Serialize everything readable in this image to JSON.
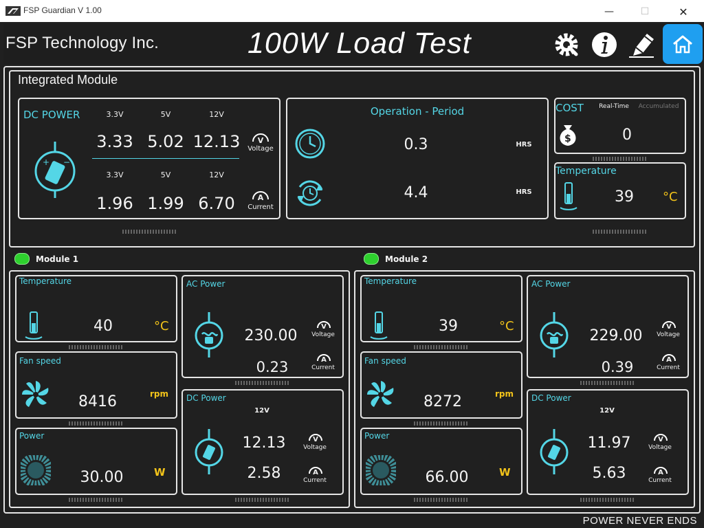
{
  "window": {
    "title": "FSP Guardian V 1.00",
    "controls": {
      "minimize": "—",
      "maximize": "☐",
      "close": "✕"
    }
  },
  "header": {
    "company": "FSP Technology Inc.",
    "test_title": "100W Load Test",
    "icons": [
      "settings-icon",
      "info-icon",
      "edit-icon",
      "home-icon"
    ]
  },
  "integrated": {
    "title": "Integrated Module",
    "dc_power": {
      "label": "DC POWER",
      "rails": [
        "3.3V",
        "5V",
        "12V"
      ],
      "voltage": [
        "3.33",
        "5.02",
        "12.13"
      ],
      "current_rails": [
        "3.3V",
        "5V",
        "12V"
      ],
      "current": [
        "1.96",
        "1.99",
        "6.70"
      ],
      "voltage_unit": "V",
      "voltage_label": "Voltage",
      "current_unit": "A",
      "current_label": "Current"
    },
    "operation": {
      "label": "Operation - Period",
      "period_value": "0.3",
      "period_unit": "HRS",
      "total_value": "4.4",
      "total_unit": "HRS"
    },
    "cost": {
      "label": "COST",
      "tab_realtime": "Real-Time",
      "tab_accumulated": "Accumulated",
      "value": "0"
    },
    "temperature": {
      "label": "Temperature",
      "value": "39",
      "unit": "°C"
    }
  },
  "modules": [
    {
      "name": "Module 1",
      "status_color": "#2ed12e",
      "temperature": {
        "label": "Temperature",
        "value": "40",
        "unit": "°C"
      },
      "fan": {
        "label": "Fan speed",
        "value": "8416",
        "unit": "rpm"
      },
      "power": {
        "label": "Power",
        "value": "30.00",
        "unit": "W"
      },
      "ac": {
        "label": "AC Power",
        "voltage": "230.00",
        "current": "0.23",
        "voltage_unit": "V",
        "voltage_label": "Voltage",
        "current_unit": "A",
        "current_label": "Current"
      },
      "dc": {
        "label": "DC Power",
        "rail": "12V",
        "voltage": "12.13",
        "current": "2.58",
        "voltage_unit": "V",
        "voltage_label": "Voltage",
        "current_unit": "A",
        "current_label": "Current"
      }
    },
    {
      "name": "Module 2",
      "status_color": "#2ed12e",
      "temperature": {
        "label": "Temperature",
        "value": "39",
        "unit": "°C"
      },
      "fan": {
        "label": "Fan speed",
        "value": "8272",
        "unit": "rpm"
      },
      "power": {
        "label": "Power",
        "value": "66.00",
        "unit": "W"
      },
      "ac": {
        "label": "AC Power",
        "voltage": "229.00",
        "current": "0.39",
        "voltage_unit": "V",
        "voltage_label": "Voltage",
        "current_unit": "A",
        "current_label": "Current"
      },
      "dc": {
        "label": "DC Power",
        "rail": "12V",
        "voltage": "11.97",
        "current": "5.63",
        "voltage_unit": "V",
        "voltage_label": "Voltage",
        "current_unit": "A",
        "current_label": "Current"
      }
    }
  ],
  "footer": {
    "slogan": "POWER NEVER ENDS"
  },
  "colors": {
    "accent_cyan": "#54d6e6",
    "unit_yellow": "#f2c31a",
    "home_blue": "#1f9ff0",
    "background": "#202020"
  }
}
